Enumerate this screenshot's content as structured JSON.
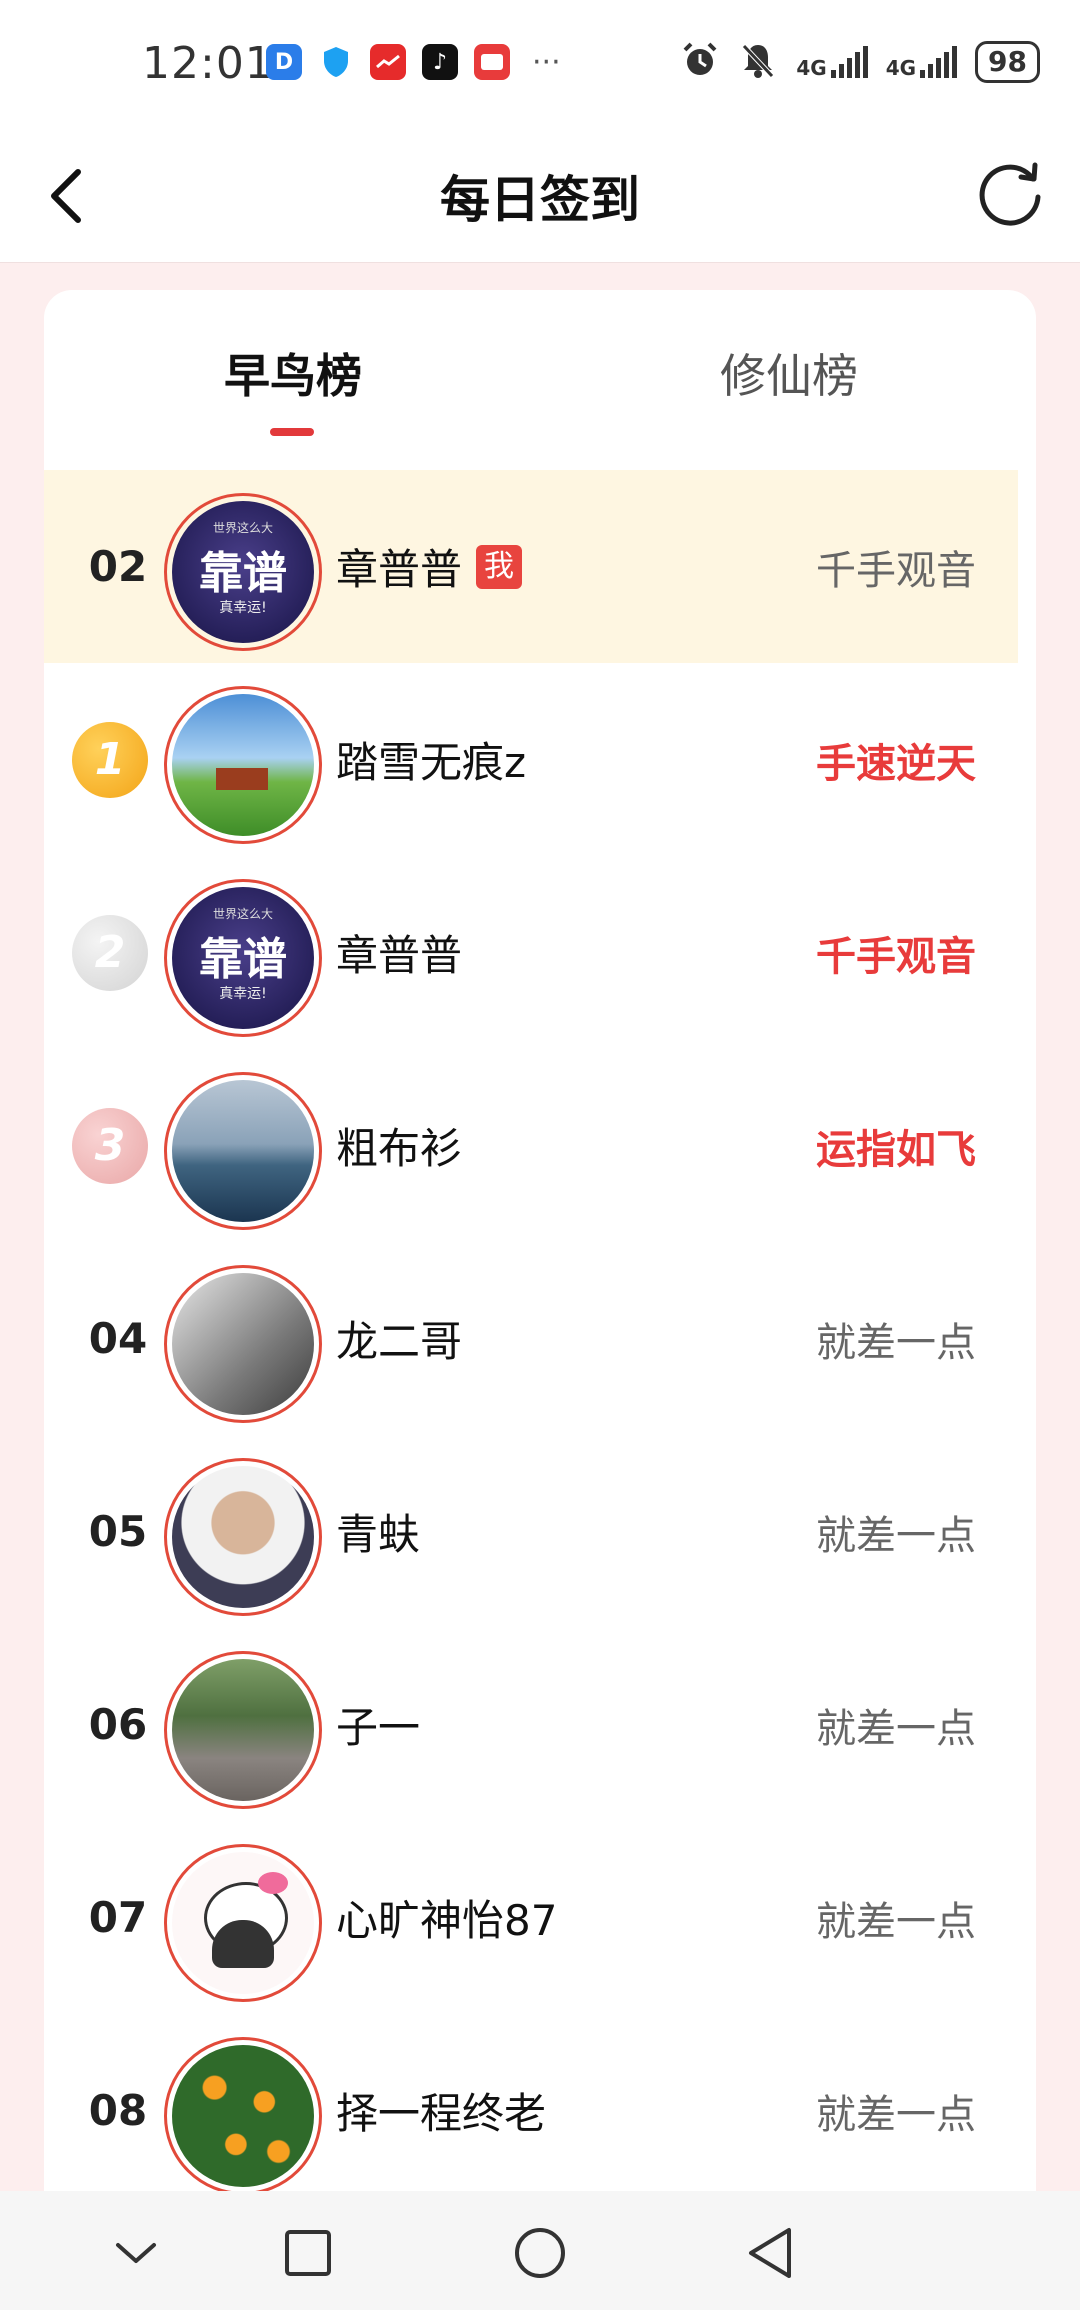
{
  "status_bar": {
    "time": "12:01",
    "net1": "4G",
    "net2": "4G",
    "battery": "98",
    "icons": [
      "alarm-icon",
      "mute-icon",
      "signal-icon",
      "signal-icon"
    ]
  },
  "header": {
    "title": "每日签到"
  },
  "tabs": [
    {
      "label": "早鸟榜",
      "active": true
    },
    {
      "label": "修仙榜",
      "active": false
    }
  ],
  "my_entry": {
    "rank": "02",
    "name": "章普普",
    "badge": "我",
    "title": "千手观音"
  },
  "rankings": [
    {
      "rank": "1",
      "name": "踏雪无痕z",
      "title": "手速逆天"
    },
    {
      "rank": "2",
      "name": "章普普",
      "title": "千手观音"
    },
    {
      "rank": "3",
      "name": "粗布衫",
      "title": "运指如飞"
    },
    {
      "rank": "04",
      "name": "龙二哥",
      "title": "就差一点"
    },
    {
      "rank": "05",
      "name": "青蚨",
      "title": "就差一点"
    },
    {
      "rank": "06",
      "name": "子一",
      "title": "就差一点"
    },
    {
      "rank": "07",
      "name": "心旷神怡87",
      "title": "就差一点"
    },
    {
      "rank": "08",
      "name": "择一程终老",
      "title": "就差一点"
    }
  ],
  "avatar_text": {
    "line1": "世界这么大",
    "line2": "靠谱",
    "line3": "真幸运!"
  },
  "colors": {
    "accent": "#e2393b",
    "highlight_row": "#fef6e1",
    "page_bg": "#fdeeee"
  }
}
